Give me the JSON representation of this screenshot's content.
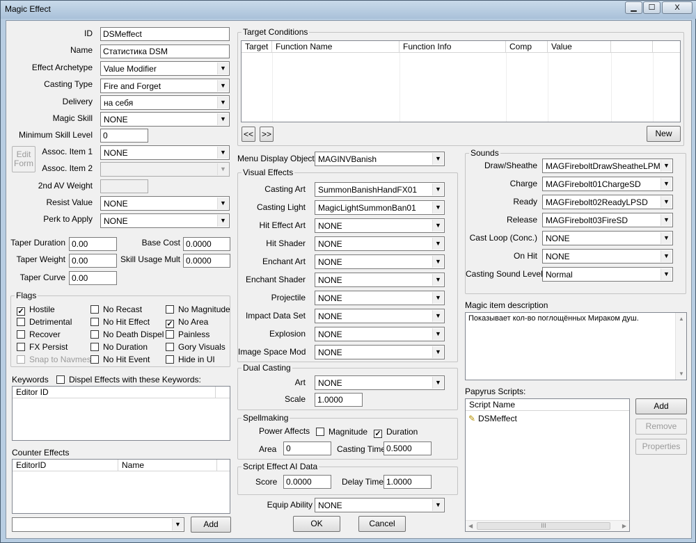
{
  "window": {
    "title": "Magic Effect",
    "min": "▁",
    "max": "☐",
    "close": "X"
  },
  "basic": {
    "id_label": "ID",
    "id": "DSMeffect",
    "name_label": "Name",
    "name": "Статистика DSM",
    "archetype_label": "Effect Archetype",
    "archetype": "Value Modifier",
    "casting_label": "Casting Type",
    "casting": "Fire and Forget",
    "delivery_label": "Delivery",
    "delivery": "на себя",
    "skill_label": "Magic Skill",
    "skill": "NONE",
    "minskill_label": "Minimum Skill Level",
    "minskill": "0",
    "edit_form": "Edit Form",
    "assoc1_label": "Assoc. Item 1",
    "assoc1": "NONE",
    "assoc2_label": "Assoc. Item 2",
    "assoc2": "",
    "av_label": "2nd AV Weight",
    "av": "",
    "resist_label": "Resist Value",
    "resist": "NONE",
    "perk_label": "Perk to Apply",
    "perk": "NONE"
  },
  "taper": {
    "duration_label": "Taper Duration",
    "duration": "0.00",
    "weight_label": "Taper Weight",
    "weight": "0.00",
    "curve_label": "Taper Curve",
    "curve": "0.00",
    "basecost_label": "Base Cost",
    "basecost": "0.0000",
    "skillmult_label": "Skill Usage Mult",
    "skillmult": "0.0000"
  },
  "flags": {
    "title": "Flags",
    "items": [
      {
        "label": "Hostile",
        "mark": "✓"
      },
      {
        "label": "No Recast",
        "mark": ""
      },
      {
        "label": "No Magnitude",
        "mark": ""
      },
      {
        "label": "Detrimental",
        "mark": ""
      },
      {
        "label": "No Hit Effect",
        "mark": ""
      },
      {
        "label": "No Area",
        "mark": "✓"
      },
      {
        "label": "Recover",
        "mark": ""
      },
      {
        "label": "No Death Dispel",
        "mark": ""
      },
      {
        "label": "Painless",
        "mark": ""
      },
      {
        "label": "FX Persist",
        "mark": ""
      },
      {
        "label": "No Duration",
        "mark": ""
      },
      {
        "label": "Gory Visuals",
        "mark": ""
      },
      {
        "label": "Snap to Navmesh",
        "mark": ""
      },
      {
        "label": "No Hit Event",
        "mark": ""
      },
      {
        "label": "Hide in UI",
        "mark": ""
      }
    ]
  },
  "keywords": {
    "label": "Keywords",
    "dispel": "Dispel Effects with these Keywords:",
    "col": "Editor ID"
  },
  "counter": {
    "label": "Counter Effects",
    "col1": "EditorID",
    "col2": "Name",
    "add": "Add",
    "combo": ""
  },
  "target": {
    "title": "Target Conditions",
    "cols": [
      "Target",
      "Function Name",
      "Function Info",
      "Comp",
      "Value"
    ],
    "prev": "<<",
    "next": ">>",
    "new": "New"
  },
  "menu": {
    "label": "Menu Display Object",
    "value": "MAGINVBanish"
  },
  "visual": {
    "title": "Visual Effects",
    "rows": [
      {
        "label": "Casting Art",
        "value": "SummonBanishHandFX01"
      },
      {
        "label": "Casting Light",
        "value": "MagicLightSummonBan01"
      },
      {
        "label": "Hit Effect Art",
        "value": "NONE"
      },
      {
        "label": "Hit Shader",
        "value": "NONE"
      },
      {
        "label": "Enchant Art",
        "value": "NONE"
      },
      {
        "label": "Enchant Shader",
        "value": "NONE"
      },
      {
        "label": "Projectile",
        "value": "NONE"
      },
      {
        "label": "Impact Data Set",
        "value": "NONE"
      },
      {
        "label": "Explosion",
        "value": "NONE"
      },
      {
        "label": "Image Space Mod",
        "value": "NONE"
      }
    ]
  },
  "dual": {
    "title": "Dual Casting",
    "art_label": "Art",
    "art": "NONE",
    "scale_label": "Scale",
    "scale": "1.0000"
  },
  "spell": {
    "title": "Spellmaking",
    "power_label": "Power Affects",
    "magnitude": "Magnitude",
    "magnitude_mark": "",
    "duration": "Duration",
    "duration_mark": "✓",
    "area_label": "Area",
    "area": "0",
    "time_label": "Casting Time",
    "time": "0.5000"
  },
  "ai": {
    "title": "Script Effect AI Data",
    "score_label": "Score",
    "score": "0.0000",
    "delay_label": "Delay Time",
    "delay": "1.0000"
  },
  "equip": {
    "label": "Equip Ability",
    "value": "NONE"
  },
  "buttons": {
    "ok": "OK",
    "cancel": "Cancel"
  },
  "sounds": {
    "title": "Sounds",
    "rows": [
      {
        "label": "Draw/Sheathe",
        "value": "MAGFireboltDrawSheatheLPMSD"
      },
      {
        "label": "Charge",
        "value": "MAGFirebolt01ChargeSD"
      },
      {
        "label": "Ready",
        "value": "MAGFirebolt02ReadyLPSD"
      },
      {
        "label": "Release",
        "value": "MAGFirebolt03FireSD"
      },
      {
        "label": "Cast Loop (Conc.)",
        "value": "NONE"
      },
      {
        "label": "On Hit",
        "value": "NONE"
      },
      {
        "label": "Casting Sound Level",
        "value": "Normal"
      }
    ]
  },
  "desc": {
    "label": "Magic item description",
    "text": "Показывает кол-во поглощённых Мираком душ."
  },
  "papyrus": {
    "label": "Papyrus Scripts:",
    "col": "Script Name",
    "script": "DSMeffect",
    "add": "Add",
    "remove": "Remove",
    "props": "Properties",
    "scroll_grip": "III"
  },
  "colors": {
    "window_bg": "#f0f0f0",
    "frame": "#b8cde2"
  }
}
